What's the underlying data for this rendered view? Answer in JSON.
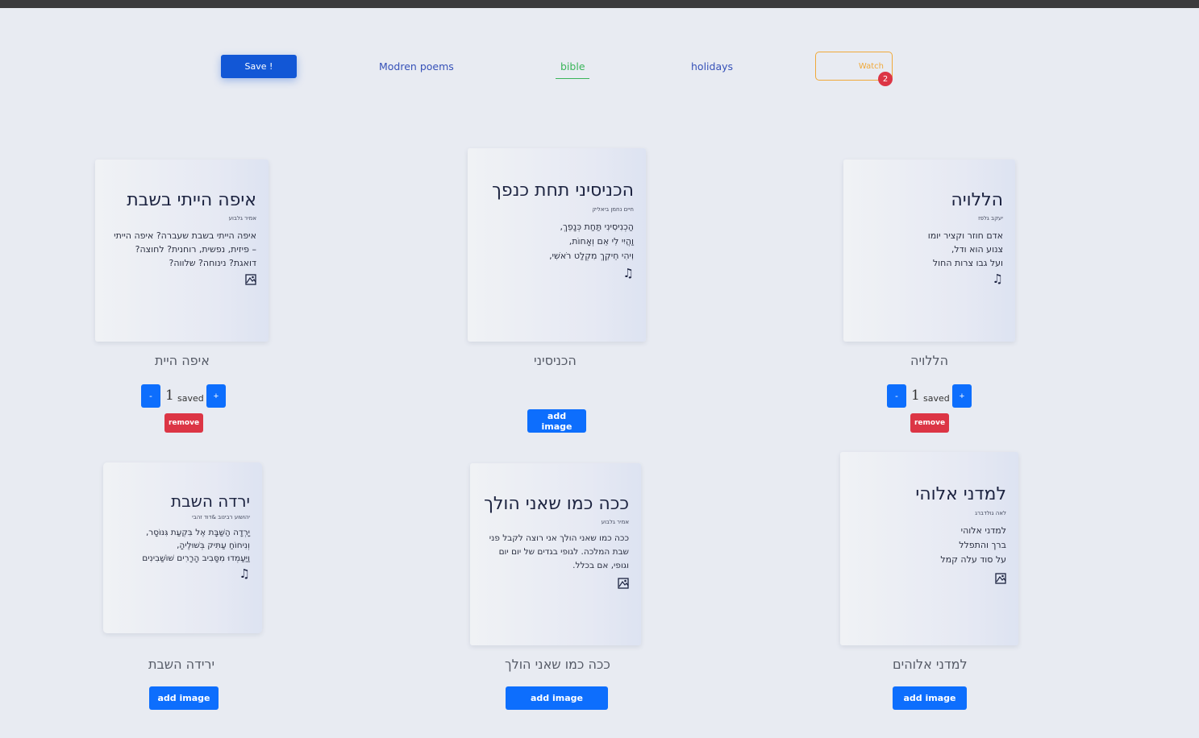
{
  "nav": {
    "save_label": "Save !",
    "links": [
      "Modren poems",
      "bible",
      "holidays"
    ],
    "watch_label": "Watch",
    "watch_count": "2"
  },
  "poems": [
    {
      "title": "איפה הייתי בשבת",
      "author": "אמיר גלבוע",
      "lines": [
        "איפה הייתי בשבת שעברה? איפה הייתי",
        "– פיזית, נפשית, רוחנית? לחוצה?",
        "דואגת? נינוחה? שלווה?"
      ],
      "icon": "image-icon",
      "caption": "איפה היית",
      "saved_count": "1",
      "saved_label": "saved",
      "minus": "-",
      "plus": "+",
      "remove_label": "remove"
    },
    {
      "title": "הכניסיני תחת כנפך",
      "author": "חיים נחמן ביאליק",
      "lines": [
        "הַכְנִיסִינִי תַּחַת כְּנָפֵךְ,",
        "וַהֲיִי לִי אֵם וְאָחוֹת,",
        "וִיהִי חֵיקֵךְ מִקְלַט רֹאשִׁי,"
      ],
      "icon": "music-icon",
      "caption": "הכניסיני",
      "add_image_label": "add image"
    },
    {
      "title": "הללויה",
      "author": "יעקב גלפז",
      "lines": [
        "אדם חוזר וקציר יומו",
        "צנוע הוא ודל,",
        "ועל גבו צרות החול"
      ],
      "icon": "music-icon",
      "caption": "הללויה",
      "saved_count": "1",
      "saved_label": "saved",
      "minus": "-",
      "plus": "+",
      "remove_label": "remove"
    },
    {
      "title": "ירדה השבת",
      "author": "יהושוע רבינוב &דוד זהבי",
      "lines": [
        "יָרְדָה הַשַּׁבָּת אֶל בִּקְעַת גִּנּוֹסָר,",
        "וְנִיחוֹחַ עַתִּיק בְּשׁוּלֶיהָ,",
        "וַיַּעַמְדוּ מִסָּבִיב הָרָרִים שׁוֹשַׁבִינִים"
      ],
      "icon": "music-icon",
      "caption": "ירידה השבת",
      "add_image_label": "add image"
    },
    {
      "title": "ככה כמו שאני הולך",
      "author": "אמיר גלבוע",
      "lines": [
        "ככה כמו שאני הולך אני רוצה לקבל פני",
        "שבת המלכה. לגופי בגדים של יום יום",
        "וגופי, אם בכלל."
      ],
      "icon": "image-icon",
      "caption": "ככה כמו שאני הולך",
      "add_image_label": "add image"
    },
    {
      "title": "למדני אלוהי",
      "author": "לאה גולדברג",
      "lines": [
        "למדני אלוהי",
        "ברך והתפלל",
        "על סוד עלה קמל"
      ],
      "icon": "image-icon",
      "caption": "למדני אלוהים",
      "add_image_label": "add image"
    }
  ]
}
